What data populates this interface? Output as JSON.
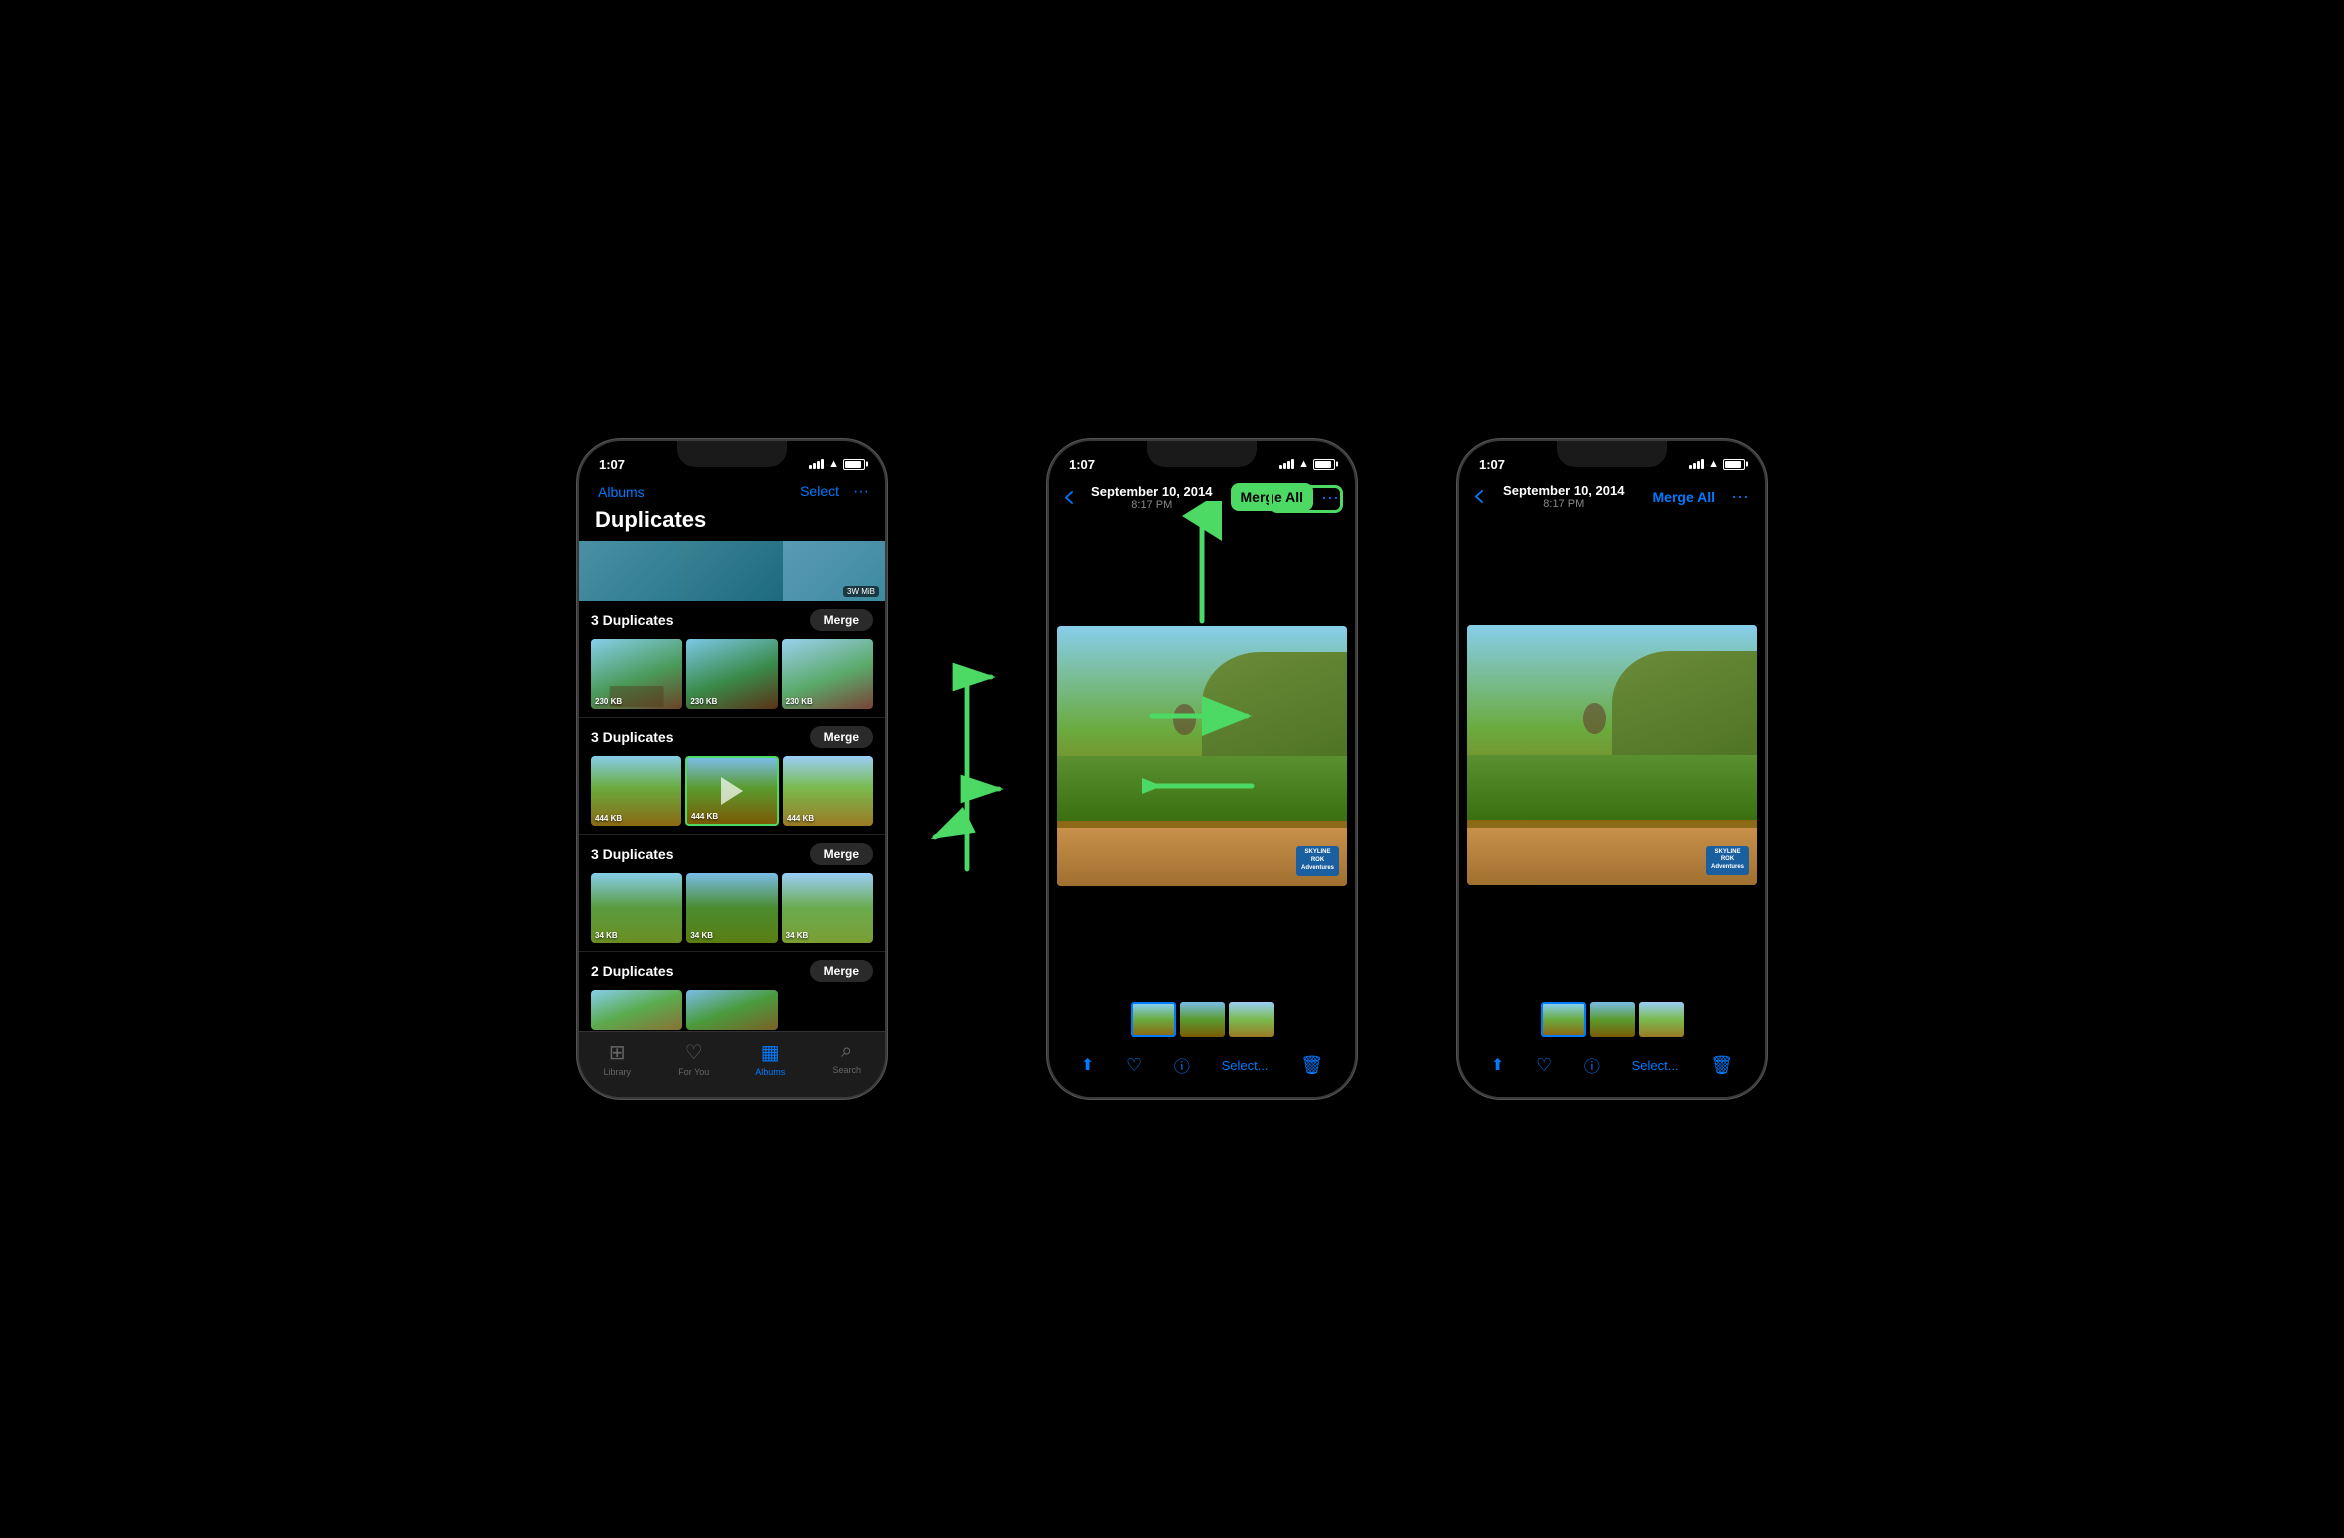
{
  "scene": {
    "background": "#000000"
  },
  "phone1": {
    "status": {
      "time": "1:07",
      "signal": true,
      "wifi": true,
      "battery": true
    },
    "nav": {
      "back_label": "Albums",
      "select_label": "Select",
      "more_label": "···"
    },
    "title": "Duplicates",
    "groups": [
      {
        "count": "3 Duplicates",
        "merge_label": "Merge",
        "photos": [
          {
            "size": "230 KB",
            "type": "group1"
          },
          {
            "size": "230 KB",
            "type": "group1b"
          },
          {
            "size": "230 KB",
            "type": "group1c"
          }
        ]
      },
      {
        "count": "3 Duplicates",
        "merge_label": "Merge",
        "highlighted": 1,
        "photos": [
          {
            "size": "444 KB",
            "type": "zipline"
          },
          {
            "size": "444 KB",
            "type": "zipline2",
            "highlight": true
          },
          {
            "size": "444 KB",
            "type": "zipline3"
          }
        ]
      },
      {
        "count": "3 Duplicates",
        "merge_label": "Merge",
        "photos": [
          {
            "size": "34 KB",
            "type": "hikers"
          },
          {
            "size": "34 KB",
            "type": "hikers2"
          },
          {
            "size": "34 KB",
            "type": "hikers3"
          }
        ]
      },
      {
        "count": "2 Duplicates",
        "merge_label": "Merge",
        "photos": []
      }
    ],
    "tabs": [
      {
        "icon": "📷",
        "label": "Library",
        "active": false
      },
      {
        "icon": "❤️",
        "label": "For You",
        "active": false
      },
      {
        "icon": "🖼",
        "label": "Albums",
        "active": true
      },
      {
        "icon": "🔍",
        "label": "Search",
        "active": false
      }
    ]
  },
  "phone2": {
    "status": {
      "time": "1:07"
    },
    "nav": {
      "back_label": "",
      "title_main": "September 10, 2014",
      "title_sub": "8:17 PM",
      "merge_all": "Merge All",
      "more": "···",
      "merge_all_highlighted": true
    },
    "main_photo_type": "zipline_main",
    "thumbnails": [
      3
    ],
    "actions": {
      "share": "↑",
      "heart": "♡",
      "info": "ⓘ",
      "select": "Select...",
      "delete": "🗑"
    }
  },
  "phone3": {
    "status": {
      "time": "1:07"
    },
    "nav": {
      "back_label": "",
      "title_main": "September 10, 2014",
      "title_sub": "8:17 PM",
      "merge_all": "Merge All",
      "more": "···",
      "merge_all_highlighted": false
    },
    "main_photo_type": "zipline_main",
    "thumbnails": [
      3
    ],
    "actions": {
      "share": "↑",
      "heart": "♡",
      "info": "ⓘ",
      "select": "Select...",
      "delete": "🗑"
    }
  }
}
